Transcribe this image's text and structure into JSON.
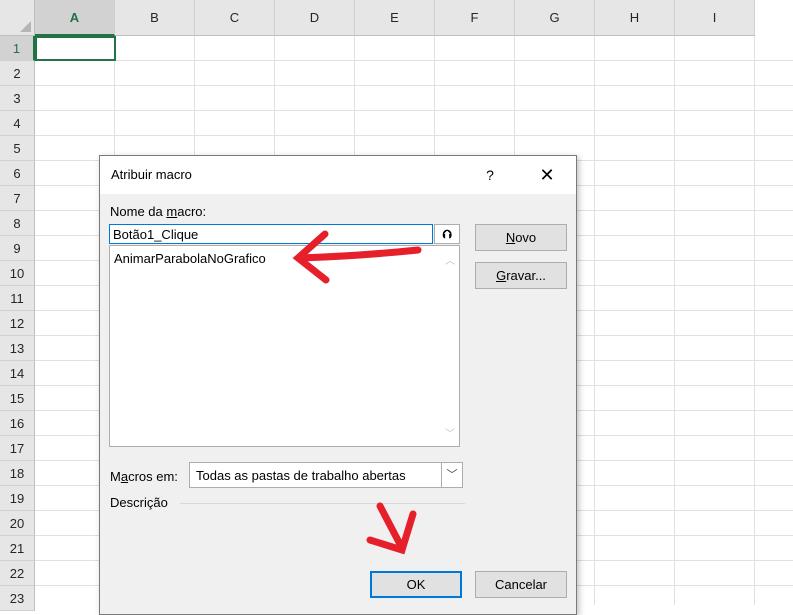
{
  "sheet": {
    "columns": [
      "A",
      "B",
      "C",
      "D",
      "E",
      "F",
      "G",
      "H",
      "I"
    ],
    "rows": [
      "1",
      "2",
      "3",
      "4",
      "5",
      "6",
      "7",
      "8",
      "9",
      "10",
      "11",
      "12",
      "13",
      "14",
      "15",
      "16",
      "17",
      "18",
      "19",
      "20",
      "21",
      "22",
      "23"
    ]
  },
  "dialog": {
    "title": "Atribuir macro",
    "help": "?",
    "close": "✕",
    "name_label_pre": "Nome da ",
    "name_label_u": "m",
    "name_label_post": "acro:",
    "name_value": "Botão1_Clique",
    "collapse_glyph": "⮉",
    "list_items": [
      "AnimarParabolaNoGrafico"
    ],
    "new_pre": "",
    "new_u": "N",
    "new_post": "ovo",
    "record_pre": "",
    "record_u": "G",
    "record_post": "ravar...",
    "macros_in_pre": "M",
    "macros_in_u": "a",
    "macros_in_post": "cros em:",
    "macros_in_value": "Todas as pastas de trabalho abertas",
    "description_label": "Descrição",
    "ok_label": "OK",
    "cancel_label": "Cancelar"
  },
  "colors": {
    "excel_green": "#217346",
    "focus_blue": "#0078d7",
    "annotation_red": "#e5202b"
  }
}
